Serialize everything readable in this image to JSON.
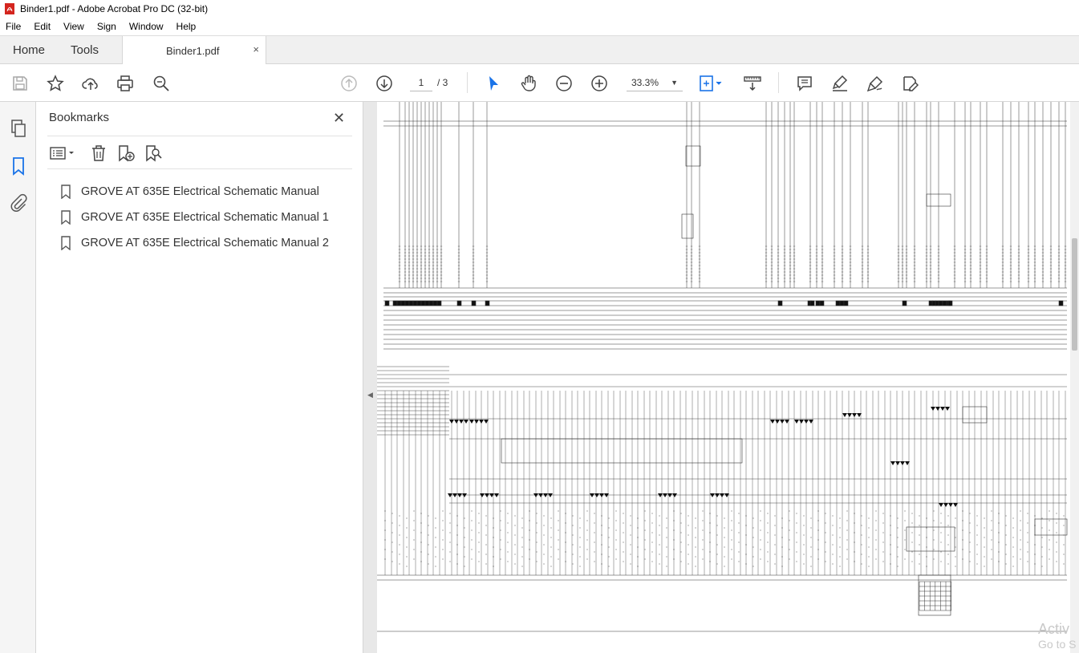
{
  "window": {
    "title": "Binder1.pdf - Adobe Acrobat Pro DC (32-bit)"
  },
  "menu": [
    "File",
    "Edit",
    "View",
    "Sign",
    "Window",
    "Help"
  ],
  "tabs": {
    "home": "Home",
    "tools": "Tools",
    "document": "Binder1.pdf",
    "close": "×"
  },
  "toolbar": {
    "current_page": "1",
    "page_total": "/ 3",
    "zoom": "33.3%"
  },
  "bookmarks": {
    "title": "Bookmarks",
    "close": "✕",
    "items": [
      "GROVE AT 635E Electrical Schematic Manual",
      "GROVE AT 635E Electrical Schematic Manual 1",
      "GROVE AT 635E Electrical Schematic Manual 2"
    ]
  },
  "watermark": {
    "line1": "Activ",
    "line2": "Go to S"
  },
  "colors": {
    "accent": "#1a73e8",
    "pdf_red": "#d4251e",
    "toolbar_bg": "#f0f0f0"
  }
}
